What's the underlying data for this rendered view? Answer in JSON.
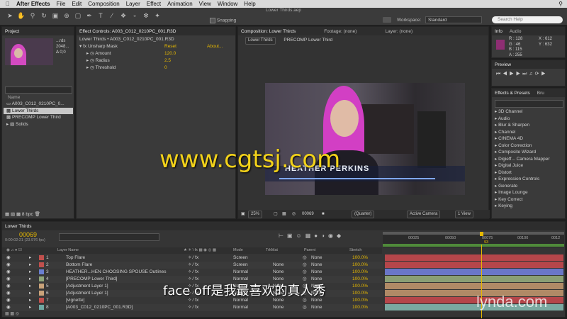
{
  "menubar": {
    "apple": "",
    "items": [
      "After Effects",
      "File",
      "Edit",
      "Composition",
      "Layer",
      "Effect",
      "Animation",
      "View",
      "Window",
      "Help"
    ]
  },
  "window_title": "Lower Thirds.aep",
  "toolbar": {
    "snapping_label": "Snapping",
    "workspace_label": "Workspace:",
    "workspace_value": "Standard",
    "search_placeholder": "Search Help"
  },
  "project": {
    "tab": "Project",
    "thumb_text_1": "...rds",
    "thumb_text_2": "2048...",
    "thumb_text_3": "Δ 0;0",
    "name_header": "Name",
    "items": [
      {
        "name": "A003_C012_0210PC_0...",
        "selected": false
      },
      {
        "name": "Lower Thirds",
        "selected": true
      },
      {
        "name": "PRECOMP Lower Third",
        "selected": false
      },
      {
        "name": "Solids",
        "selected": false
      }
    ],
    "bpc": "8 bpc"
  },
  "effects": {
    "tab": "Effect Controls: A003_C012_0210PC_001.R3D",
    "path": "Lower Thirds • A003_C012_0210PC_001.R3D",
    "effect_name": "Unsharp Mask",
    "reset": "Reset",
    "about": "About...",
    "params": [
      {
        "label": "Amount",
        "value": "120.0"
      },
      {
        "label": "Radius",
        "value": "2.5"
      },
      {
        "label": "Threshold",
        "value": "0"
      }
    ]
  },
  "composition": {
    "tab": "Composition: Lower Thirds",
    "footage_tab": "Footage: (none)",
    "layer_tab": "Layer: (none)",
    "subtabs": [
      "Lower Thirds",
      "PRECOMP Lower Third"
    ],
    "lower_third_name": "HEATHER PERKINS",
    "zoom": "25%",
    "timecode": "00069",
    "quality": "(Quarter)",
    "camera": "Active Camera",
    "view": "1 View"
  },
  "info": {
    "tab": "Info",
    "audio_tab": "Audio",
    "r": "R : 128",
    "g": "G : 46",
    "b": "B : 115",
    "a": "A : 255",
    "x": "X : 612",
    "y": "Y : 632",
    "swatch_color": "#8e2e73"
  },
  "preview": {
    "tab": "Preview"
  },
  "effects_presets": {
    "tab": "Effects & Presets",
    "brush_tab": "Bru",
    "items": [
      "3D Channel",
      "Audio",
      "Blur & Sharpen",
      "Channel",
      "CINEMA 4D",
      "Color Correction",
      "Composite Wizard",
      "Digieff... Camera Mapper",
      "Digital Juice",
      "Distort",
      "Expression Controls",
      "Generate",
      "Image Lounge",
      "Key Correct",
      "Keying"
    ]
  },
  "timeline": {
    "tab": "Lower Thirds",
    "timecode": "00069",
    "timecode_sub": "0:00:02:21 (23.976 fps)",
    "headers": {
      "layer_name": "Layer Name",
      "mode": "Mode",
      "trkmat": "TrkMat",
      "parent": "Parent",
      "stretch": "Stretch"
    },
    "ruler": [
      "00025",
      "00050",
      "00075",
      "00100",
      "0012"
    ],
    "playhead_label": "93",
    "layers": [
      {
        "num": "1",
        "name": "Top Flare",
        "mode": "Screen",
        "trkmat": "",
        "parent": "None",
        "stretch": "100.0%",
        "label": "#c0504d",
        "bar": "#b5464a"
      },
      {
        "num": "2",
        "name": "Bottom Flare",
        "mode": "Screen",
        "trkmat": "None",
        "parent": "None",
        "stretch": "100.0%",
        "label": "#c0504d",
        "bar": "#b5464a"
      },
      {
        "num": "3",
        "name": "HEATHER...HEN CHOOSING SPOUSE Outlines",
        "mode": "Normal",
        "trkmat": "None",
        "parent": "None",
        "stretch": "100.0%",
        "label": "#6a7fd1",
        "bar": "#6a76c8"
      },
      {
        "num": "4",
        "name": "[PRECOMP Lower Third]",
        "mode": "Normal",
        "trkmat": "None",
        "parent": "None",
        "stretch": "100.0%",
        "label": "#8fa57a",
        "bar": "#8a9e74"
      },
      {
        "num": "5",
        "name": "[Adjustment Layer 1]",
        "mode": "Normal",
        "trkmat": "None",
        "parent": "None",
        "stretch": "100.0%",
        "label": "#c9a37a",
        "bar": "#b08a66"
      },
      {
        "num": "6",
        "name": "[Adjustment Layer 1]",
        "mode": "Normal",
        "trkmat": "None",
        "parent": "None",
        "stretch": "100.0%",
        "label": "#c9a37a",
        "bar": "#b08a66"
      },
      {
        "num": "7",
        "name": "[vignette]",
        "mode": "Normal",
        "trkmat": "None",
        "parent": "None",
        "stretch": "100.0%",
        "label": "#c0504d",
        "bar": "#b5464a"
      },
      {
        "num": "8",
        "name": "[A003_C012_0210PC_001.R3D]",
        "mode": "Normal",
        "trkmat": "None",
        "parent": "None",
        "stretch": "100.0%",
        "label": "#6fa8a3",
        "bar": "#7aa9a1"
      }
    ]
  },
  "overlays": {
    "watermark": "www.cgtsj.com",
    "subtitle": "face off是我最喜欢的真人秀",
    "lynda": "lynda.com"
  }
}
